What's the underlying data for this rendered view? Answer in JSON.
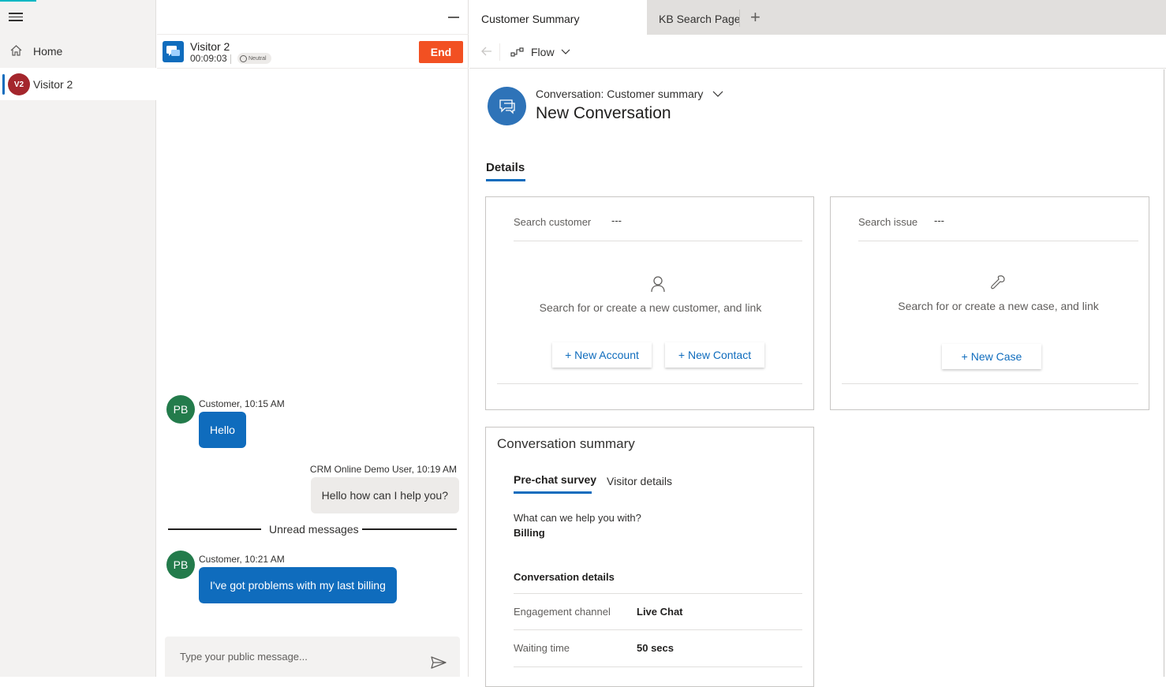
{
  "nav": {
    "home_label": "Home",
    "visitor": {
      "initials": "V2",
      "label": "Visitor 2"
    }
  },
  "chat": {
    "visitor_name": "Visitor 2",
    "timer": "00:09:03",
    "sentiment": "Neutral",
    "end_label": "End",
    "messages": [
      {
        "avatar": "PB",
        "meta": "Customer, 10:15 AM",
        "text": "Hello"
      },
      {
        "meta": "CRM Online Demo User, 10:19 AM",
        "text": "Hello how can I help you?"
      },
      {
        "avatar": "PB",
        "meta": "Customer, 10:21 AM",
        "text": "I've got problems with my last billing"
      }
    ],
    "unread_label": "Unread messages",
    "composer_placeholder": "Type your public message..."
  },
  "workspace": {
    "tabs": [
      "Customer Summary",
      "KB Search Page"
    ],
    "flow_label": "Flow",
    "form_selector": "Conversation: Customer summary",
    "record_title": "New Conversation",
    "details_tab": "Details",
    "customer_card": {
      "search_label": "Search customer",
      "search_value": "---",
      "empty_text": "Search for or create a new customer, and link",
      "new_account": "+ New Account",
      "new_contact": "+ New Contact"
    },
    "issue_card": {
      "search_label": "Search issue",
      "search_value": "---",
      "empty_text": "Search for or create a new case, and link",
      "new_case": "+ New Case"
    },
    "summary": {
      "title": "Conversation summary",
      "tabs": [
        "Pre-chat survey",
        "Visitor details"
      ],
      "question": "What can we help you with?",
      "answer": "Billing",
      "details_heading": "Conversation details",
      "rows": [
        {
          "label": "Engagement channel",
          "value": "Live Chat"
        },
        {
          "label": "Waiting time",
          "value": "50 secs"
        }
      ]
    }
  },
  "colors": {
    "accent": "#0f6cbd",
    "end_button": "#f25022",
    "customer_avatar": "#237b4b",
    "visitor_avatar": "#a4262c"
  }
}
